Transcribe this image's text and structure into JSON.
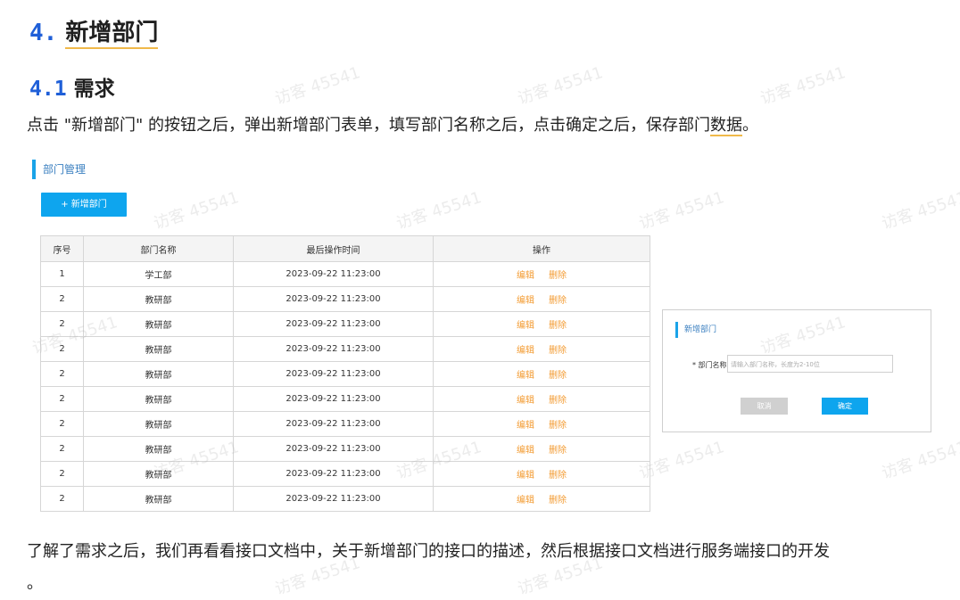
{
  "heading1": {
    "number": "4.",
    "title": "新增部门"
  },
  "heading2": {
    "number": "4.1",
    "title": "需求"
  },
  "paragraph1": {
    "before": "点击 \"新增部门\" 的按钮之后，弹出新增部门表单，填写部门名称之后，点击确定之后，保存部门",
    "underlined": "数据",
    "after": "。"
  },
  "mockup": {
    "panel_title": "部门管理",
    "add_button": "+ 新增部门",
    "columns": [
      "序号",
      "部门名称",
      "最后操作时间",
      "操作"
    ],
    "rows": [
      {
        "no": "1",
        "name": "学工部",
        "time": "2023-09-22 11:23:00"
      },
      {
        "no": "2",
        "name": "教研部",
        "time": "2023-09-22 11:23:00"
      },
      {
        "no": "2",
        "name": "教研部",
        "time": "2023-09-22 11:23:00"
      },
      {
        "no": "2",
        "name": "教研部",
        "time": "2023-09-22 11:23:00"
      },
      {
        "no": "2",
        "name": "教研部",
        "time": "2023-09-22 11:23:00"
      },
      {
        "no": "2",
        "name": "教研部",
        "time": "2023-09-22 11:23:00"
      },
      {
        "no": "2",
        "name": "教研部",
        "time": "2023-09-22 11:23:00"
      },
      {
        "no": "2",
        "name": "教研部",
        "time": "2023-09-22 11:23:00"
      },
      {
        "no": "2",
        "name": "教研部",
        "time": "2023-09-22 11:23:00"
      },
      {
        "no": "2",
        "name": "教研部",
        "time": "2023-09-22 11:23:00"
      }
    ],
    "edit_label": "编辑",
    "delete_label": "删除",
    "dialog": {
      "title": "新增部门",
      "field_label": "* 部门名称",
      "field_placeholder": "请输入部门名称，长度为2-10位",
      "cancel_label": "取消",
      "confirm_label": "确定"
    }
  },
  "paragraph2": {
    "line1": "了解了需求之后，我们再看看接口文档中，关于新增部门的接口的描述，然后根据接口文档进行服务端接口的开发",
    "line2": "。"
  },
  "watermark": "访客 45541"
}
